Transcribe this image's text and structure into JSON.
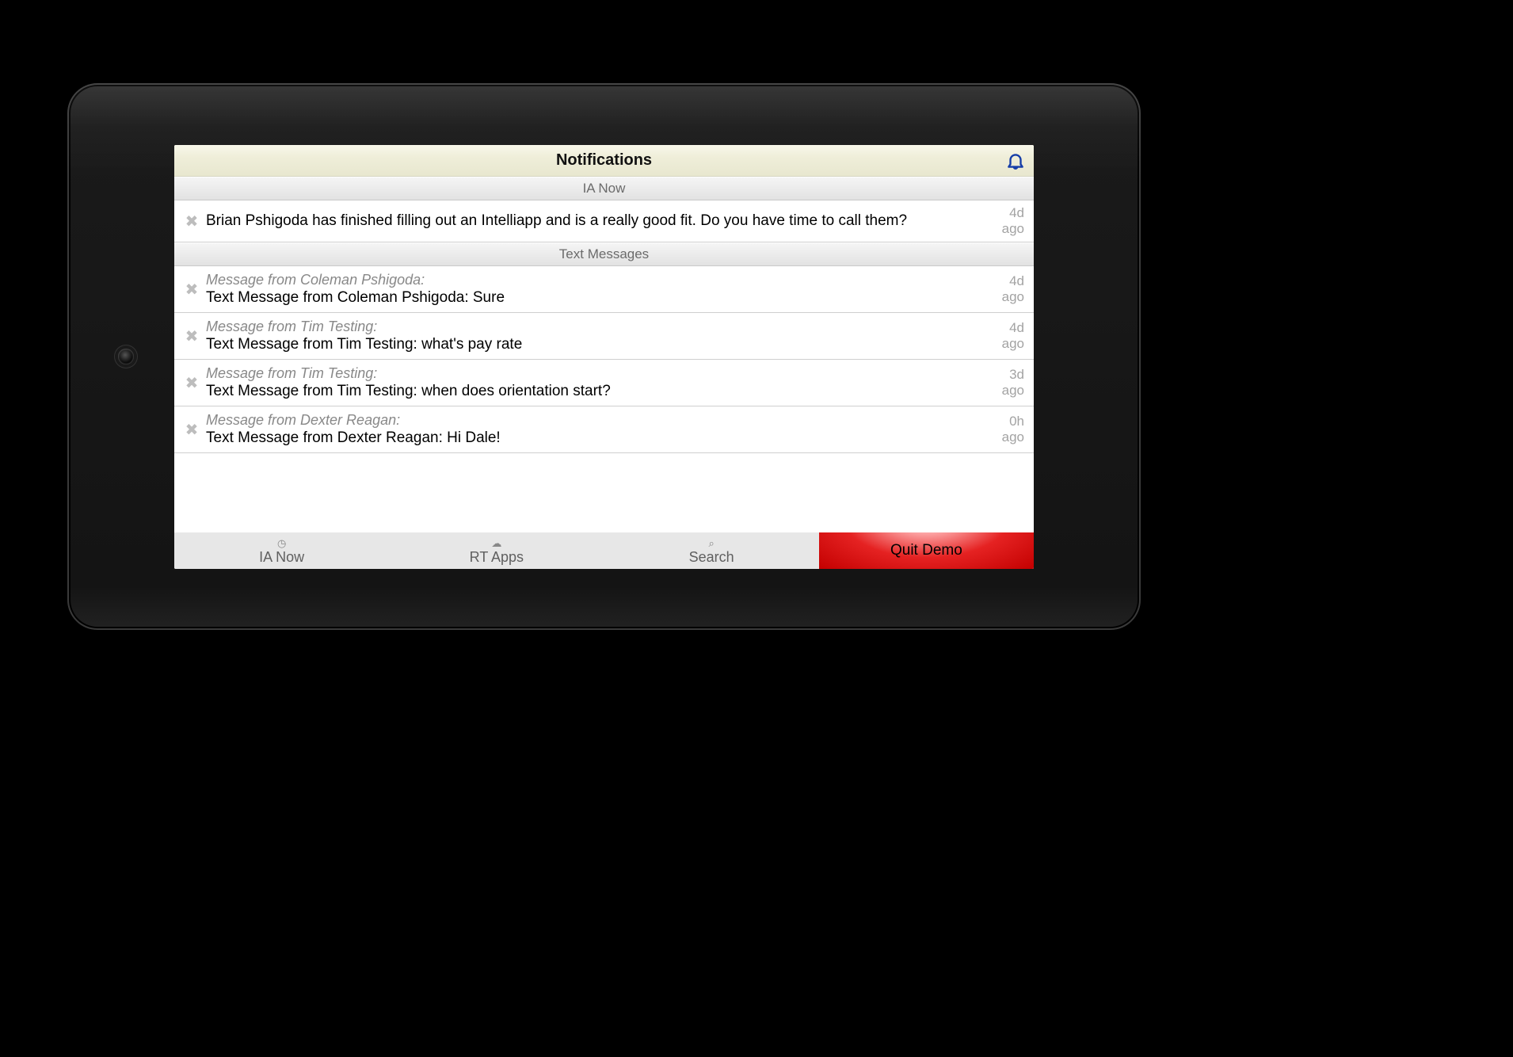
{
  "header": {
    "title": "Notifications"
  },
  "sections": {
    "ianow": {
      "label": "IA Now"
    },
    "texts": {
      "label": "Text Messages"
    }
  },
  "notifications": {
    "ianow": [
      {
        "message": "Brian Pshigoda has finished filling out an Intelliapp and is a really good fit. Do you have time to call them?",
        "time_top": "4d",
        "time_bottom": "ago"
      }
    ],
    "texts": [
      {
        "subhead": "Message from Coleman Pshigoda:",
        "message": "Text Message from Coleman Pshigoda: Sure",
        "time_top": "4d",
        "time_bottom": "ago"
      },
      {
        "subhead": "Message from Tim Testing:",
        "message": "Text Message from Tim Testing: what's pay rate",
        "time_top": "4d",
        "time_bottom": "ago"
      },
      {
        "subhead": "Message from Tim Testing:",
        "message": "Text Message from Tim Testing: when does orientation start?",
        "time_top": "3d",
        "time_bottom": "ago"
      },
      {
        "subhead": "Message from Dexter Reagan:",
        "message": "Text Message from Dexter Reagan: Hi Dale!",
        "time_top": "0h",
        "time_bottom": "ago"
      }
    ]
  },
  "tabs": {
    "ianow": "IA Now",
    "rtapps": "RT Apps",
    "search": "Search",
    "quit": "Quit Demo"
  },
  "icons": {
    "dismiss": "✖",
    "clock": "◷",
    "cloud": "☁",
    "search": "⌕"
  }
}
